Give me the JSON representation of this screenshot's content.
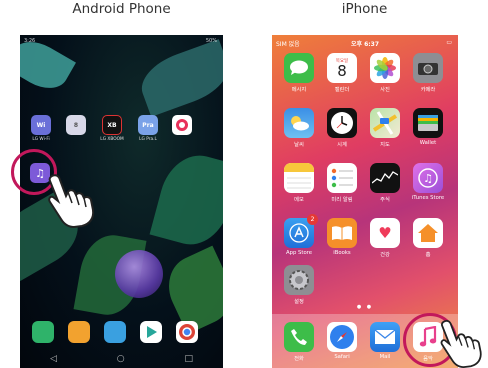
{
  "captions": {
    "android": "Android Phone",
    "iphone": "iPhone"
  },
  "android": {
    "status_time": "3:26",
    "status_right": "50%",
    "apps": [
      {
        "label": "LG Wi-Fi",
        "color": "#6a6fd8",
        "glyph": "Wi"
      },
      {
        "label": "",
        "color": "#d8d8e8",
        "glyph": "8"
      },
      {
        "label": "LG XBOOM",
        "color": "#111111",
        "glyph": "XB"
      },
      {
        "label": "LG Pra.L",
        "color": "#7aa2e8",
        "glyph": "Pra"
      },
      {
        "label": "",
        "color": "#e8305a",
        "glyph": ""
      }
    ],
    "music_label": "",
    "accent": "#c2185b"
  },
  "iphone": {
    "status_left": "SIM 없음",
    "status_time": "오후 6:37",
    "apps": [
      {
        "label": "메시지",
        "color": "#3dbd49",
        "glyph": ""
      },
      {
        "label": "캘린더",
        "color": "#ffffff",
        "glyph": "8",
        "sub": "목요일"
      },
      {
        "label": "사진",
        "color": "#ffffff",
        "glyph": ""
      },
      {
        "label": "카메라",
        "color": "#8e8e93",
        "glyph": ""
      },
      {
        "label": "날씨",
        "color": "#3a8fe0",
        "glyph": ""
      },
      {
        "label": "시계",
        "color": "#111111",
        "glyph": ""
      },
      {
        "label": "지도",
        "color": "#7ec26b",
        "glyph": ""
      },
      {
        "label": "Wallet",
        "color": "#111111",
        "glyph": ""
      },
      {
        "label": "메모",
        "color": "#ffffff",
        "glyph": ""
      },
      {
        "label": "미리 알림",
        "color": "#ffffff",
        "glyph": ""
      },
      {
        "label": "주식",
        "color": "#111111",
        "glyph": ""
      },
      {
        "label": "iTunes Store",
        "color": "#c36bd8",
        "glyph": ""
      },
      {
        "label": "App Store",
        "color": "#2c8ef0",
        "glyph": "",
        "badge": "2"
      },
      {
        "label": "iBooks",
        "color": "#f5902a",
        "glyph": ""
      },
      {
        "label": "건강",
        "color": "#ffffff",
        "glyph": ""
      },
      {
        "label": "홈",
        "color": "#ffffff",
        "glyph": ""
      },
      {
        "label": "설정",
        "color": "#8e8e93",
        "glyph": ""
      }
    ],
    "dock": [
      {
        "label": "전화",
        "color": "#3dbd49"
      },
      {
        "label": "Safari",
        "color": "#2f80ed"
      },
      {
        "label": "Mail",
        "color": "#2b7be0"
      },
      {
        "label": "음악",
        "color": "#ffffff"
      }
    ]
  }
}
